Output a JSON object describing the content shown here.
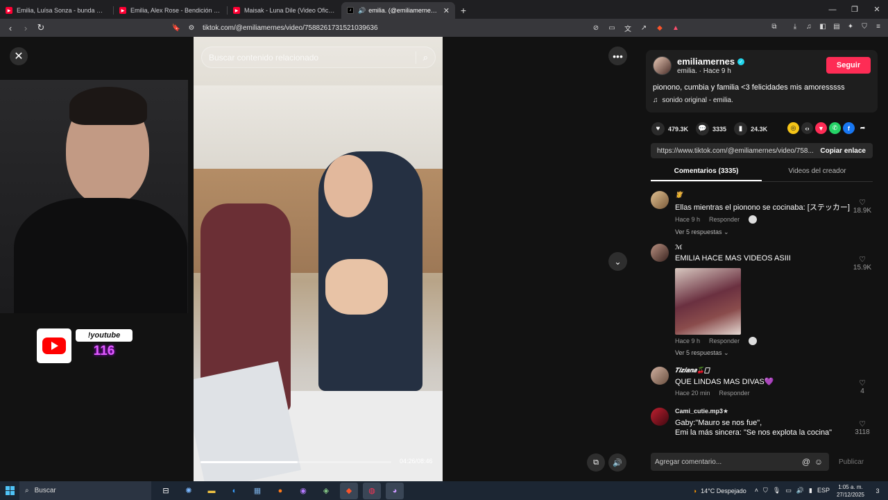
{
  "browser": {
    "tabs": [
      {
        "title": "Emilia, Luísa Sonza - bunda 🤎 (Offic",
        "favicon": "youtube-icon",
        "active": false
      },
      {
        "title": "Emilia, Alex Rose - Bendición (Officia",
        "favicon": "youtube-icon",
        "active": false
      },
      {
        "title": "Maisak - Luna Dile (Video Oficial) - Yo",
        "favicon": "youtube-icon",
        "active": false
      },
      {
        "title": "emilia. (@emiliamernes) oficia",
        "favicon": "tiktok-icon",
        "active": true
      }
    ],
    "url": "tiktok.com/@emiliamernes/video/7588261731521039636"
  },
  "stream_overlay": {
    "command": "!youtube",
    "count": "116"
  },
  "video": {
    "search_placeholder": "Buscar contenido relacionado",
    "timestamp": "04:26/08:46",
    "progress_fraction": 0.51
  },
  "panel": {
    "username": "emiliamernes",
    "meta": "emilia. · Hace 9 h",
    "follow_label": "Seguir",
    "description": "piono­no, cumbia y familia <3 felicidades mis amoresssss",
    "music": "sonido original - emilia.",
    "likes": "479.3K",
    "comments": "3335",
    "saves": "24.3K",
    "link": "https://www.tiktok.com/@emiliamernes/video/758...",
    "copy_label": "Copiar enlace",
    "tab_comments": "Comentarios (3335)",
    "tab_creator": "Videos del creador"
  },
  "comments": [
    {
      "name": "👸",
      "text": "Ellas mientras el piono­no se cocinaba: [ステッカー]",
      "time": "Hace 9 h",
      "reply": "Responder",
      "replies": "Ver 5 respuestas ⌄",
      "likes": "18.9K"
    },
    {
      "name": "ℳ",
      "text": "EMILIA HACE MAS VIDEOS ASIII",
      "time": "Hace 9 h",
      "reply": "Responder",
      "replies": "Ver 5 respuestas ⌄",
      "likes": "15.9K"
    },
    {
      "name": "𝑻𝒊𝒛𝒊𝒂𝒏𝒂🍒🀆",
      "text": "QUE LINDAS MAS DIVAS💜",
      "time": "Hace 20 min",
      "reply": "Responder",
      "likes": "4"
    },
    {
      "name": "Cami_cutie.mp3★",
      "text": "Gaby:\"Mauro se nos fue\",\nEmi la más sincera: \"Se nos explota la cocina\"",
      "likes": "3118"
    }
  ],
  "comment_bar": {
    "placeholder": "Agregar comentario...",
    "publish": "Publicar"
  },
  "taskbar": {
    "search": "Buscar",
    "weather": "14°C  Despejado",
    "lang": "ESP",
    "time": "1:05 a. m.",
    "date": "27/12/2025",
    "notif_count": "3"
  }
}
